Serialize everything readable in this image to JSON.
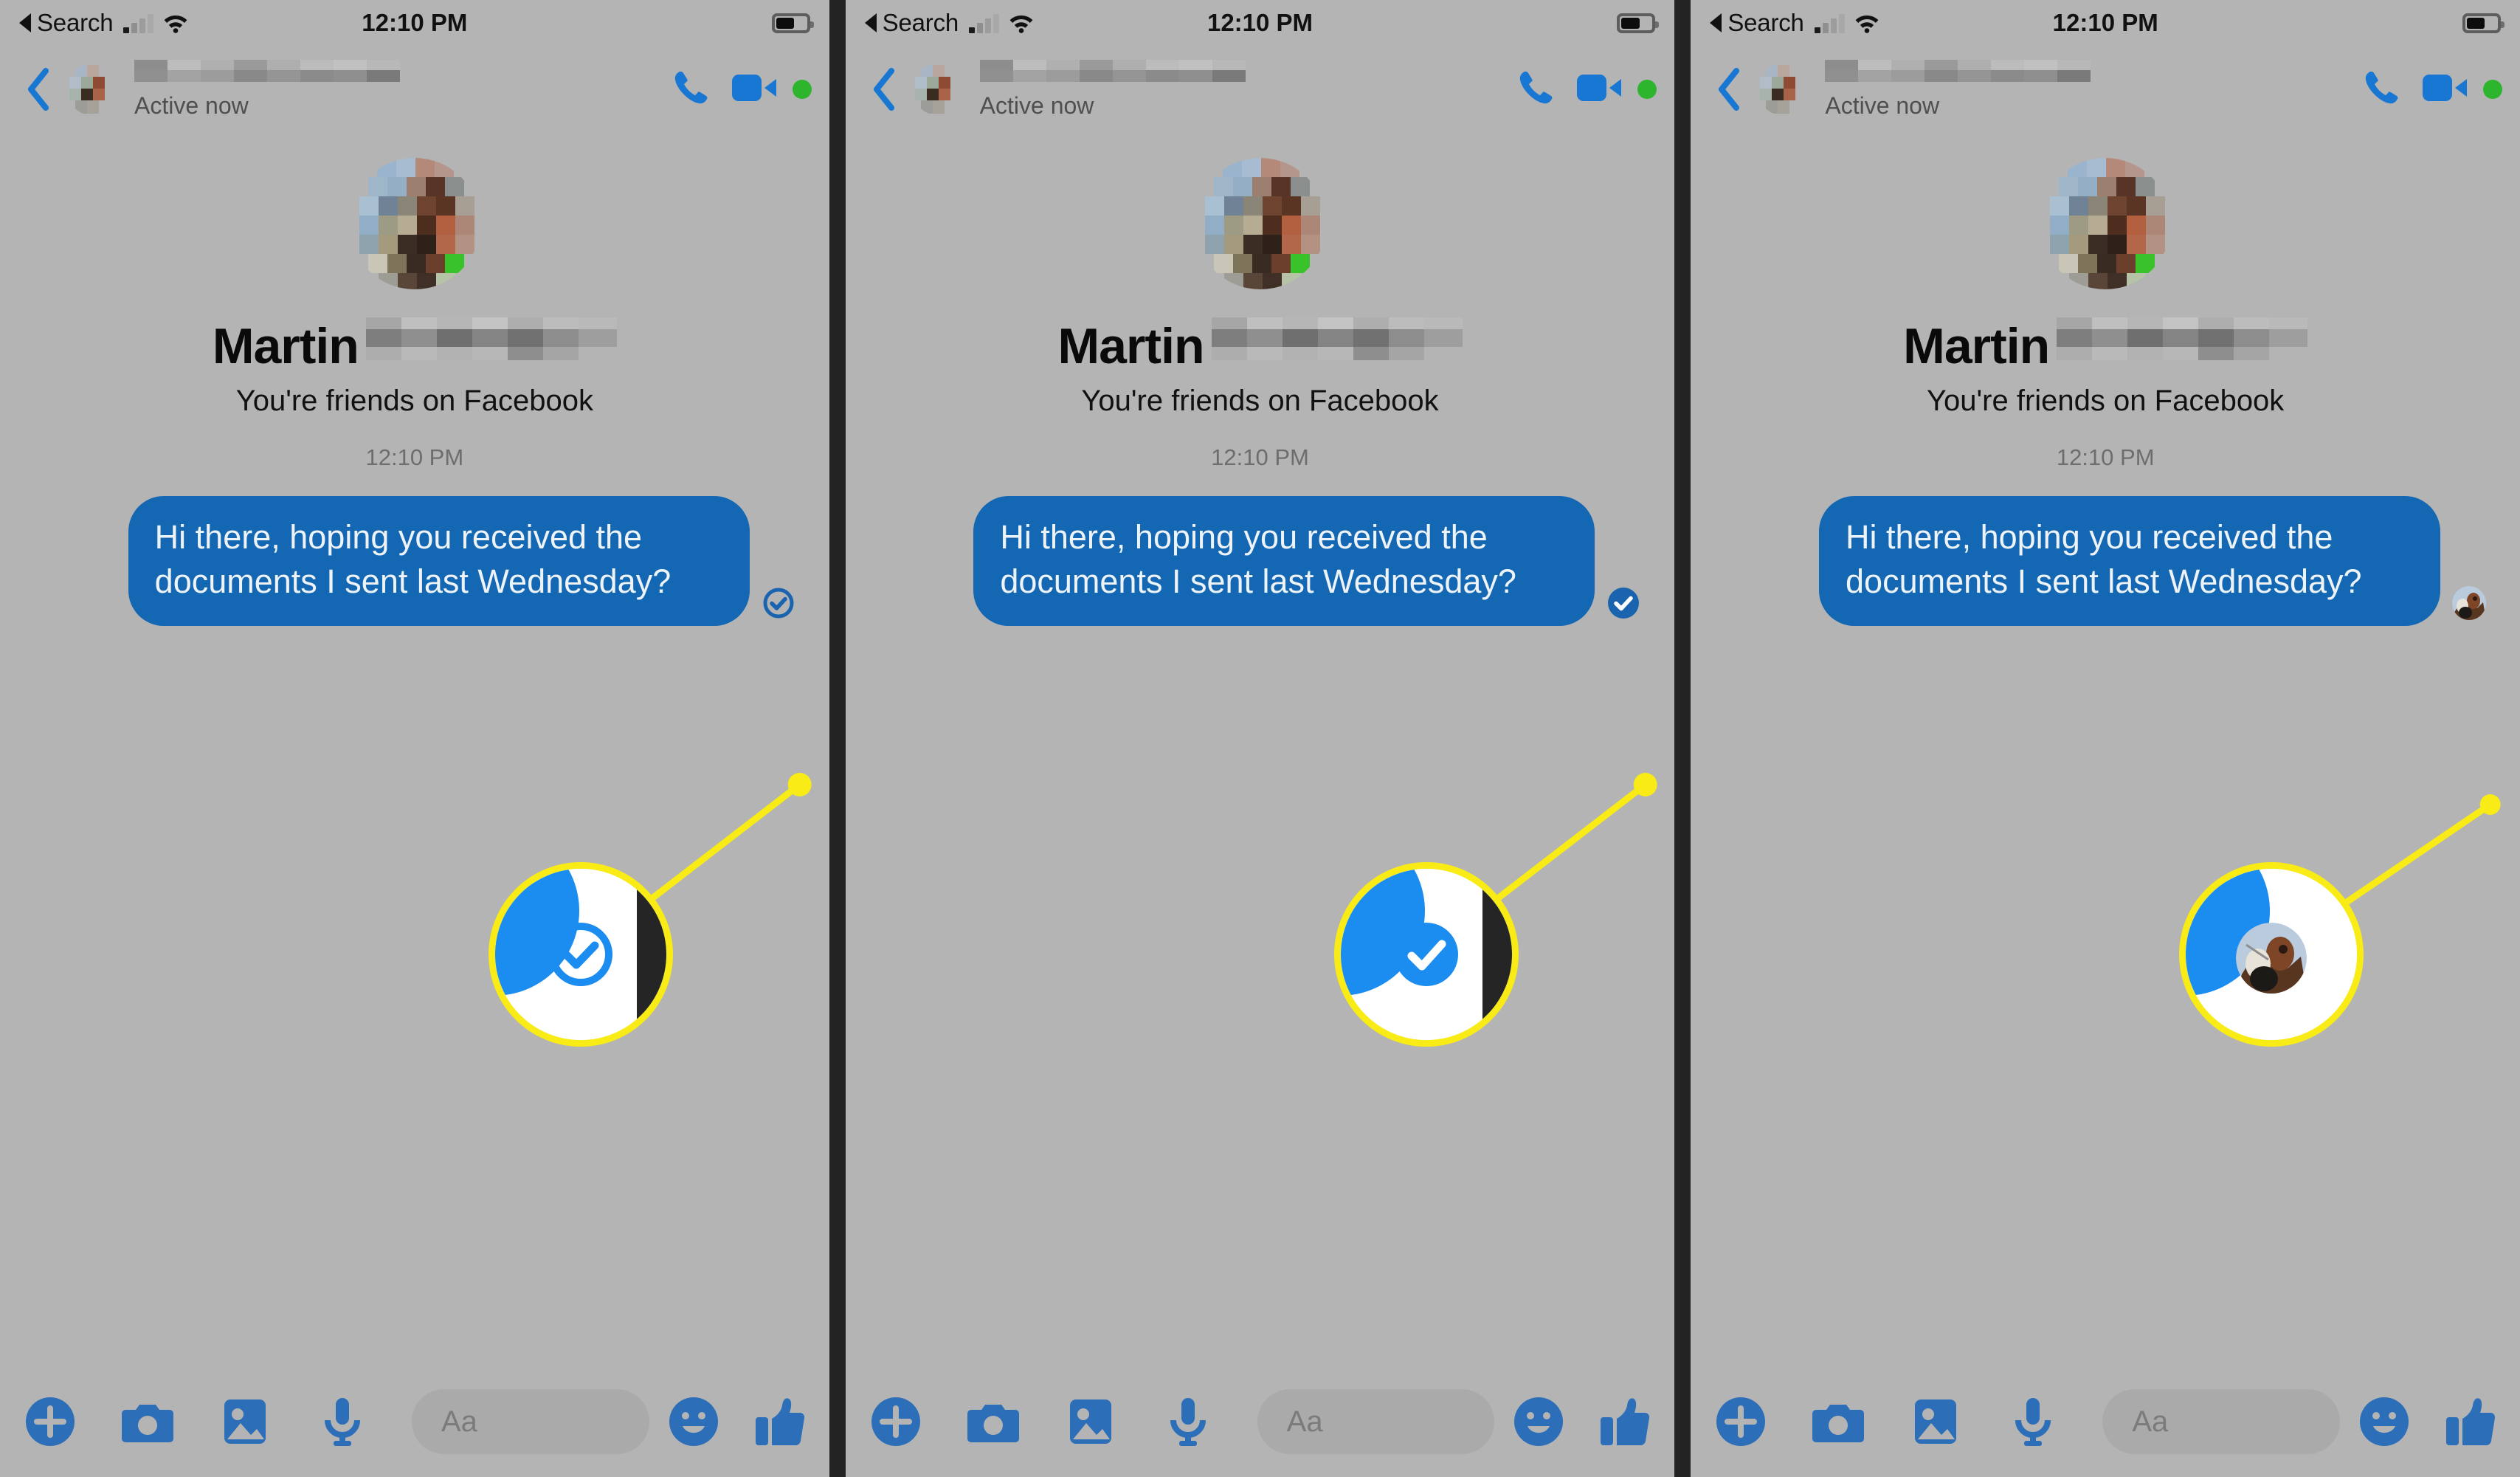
{
  "theme": {
    "background": "#b4b4b4",
    "bubble_blue": "#1467b3",
    "accent_blue": "#1b7ed6",
    "callout_yellow": "#f8eb16",
    "online_green": "#2db52d",
    "divider": "#232323"
  },
  "status_bar": {
    "back_label": "Search",
    "time": "12:10 PM",
    "signal_icon": "signal-bars-icon",
    "wifi_icon": "wifi-icon",
    "battery_icon": "battery-icon",
    "battery_level": 55
  },
  "nav_bar": {
    "back_icon": "chevron-left-icon",
    "avatar_icon": "contact-avatar",
    "contact_name": "",
    "contact_name_redacted": true,
    "presence": "Active now",
    "call_icon": "phone-icon",
    "video_icon": "video-camera-icon",
    "online_indicator": "online-status-dot"
  },
  "profile": {
    "avatar_icon": "profile-photo",
    "first_name": "Martin",
    "last_name": "",
    "last_name_redacted": true,
    "relationship": "You're friends on Facebook",
    "timestamp": "12:10 PM"
  },
  "message": {
    "text": "Hi there, hoping you received the documents I sent last Wednesday?",
    "direction": "outgoing"
  },
  "panels": [
    {
      "index": 1,
      "state_name": "sent",
      "status_icon": "check-circle-outline-icon",
      "magnifier_content": "check-circle-outline-icon"
    },
    {
      "index": 2,
      "state_name": "delivered",
      "status_icon": "check-circle-filled-icon",
      "magnifier_content": "check-circle-filled-icon"
    },
    {
      "index": 3,
      "state_name": "read",
      "status_icon": "reader-avatar-icon",
      "magnifier_content": "reader-avatar-icon"
    }
  ],
  "bottom_bar": {
    "input_placeholder": "Aa",
    "left_icons": [
      {
        "name": "plus-circle-icon",
        "label": "More actions"
      },
      {
        "name": "camera-icon",
        "label": "Camera"
      },
      {
        "name": "gallery-icon",
        "label": "Photos"
      },
      {
        "name": "microphone-icon",
        "label": "Voice message"
      }
    ],
    "right_icons": [
      {
        "name": "emoji-smiley-icon",
        "label": "Stickers"
      },
      {
        "name": "thumbs-up-icon",
        "label": "Like"
      }
    ]
  }
}
